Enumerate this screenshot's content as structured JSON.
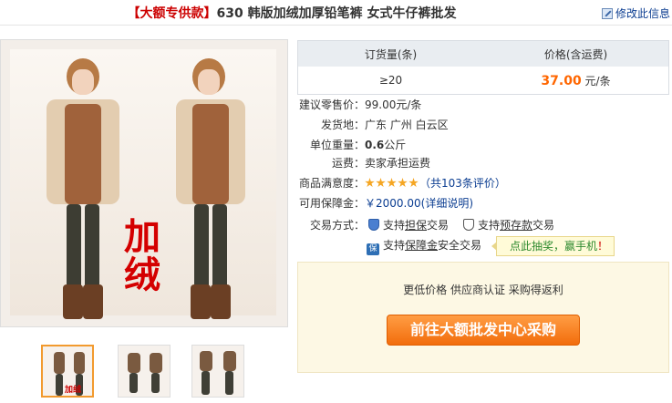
{
  "title": {
    "brand": "【大额专供款】",
    "text": "630 韩版加绒加厚铅笔裤 女式牛仔裤批发"
  },
  "edit_link": "修改此信息",
  "photo": {
    "overlay_text_1": "加",
    "overlay_text_2": "绒"
  },
  "thumbnails": {
    "first_label": "加绒"
  },
  "price_table": {
    "headers": [
      "订货量(条)",
      "价格(含运费)"
    ],
    "quantity": "≥20",
    "price": "37.00",
    "unit": " 元/条"
  },
  "info": {
    "retail_label": "建议零售价：",
    "retail_value": "99.00元/条",
    "ship_label": "发货地：",
    "ship_value": "广东 广州 白云区",
    "weight_label": "单位重量：",
    "weight_value": "0.6",
    "weight_unit": "公斤",
    "freight_label": "运费：",
    "freight_value": "卖家承担运费",
    "rating_label": "商品满意度：",
    "rating_stars": 5,
    "rating_count": "（共103条评价）",
    "guarantee_label": "可用保障金：",
    "guarantee_value": "￥2000.00",
    "guarantee_link": "(详细说明)",
    "trade_label": "交易方式：",
    "trade_1_prefix": "支持",
    "trade_1_link": "担保",
    "trade_1_suffix": "交易",
    "trade_2_prefix": "支持",
    "trade_2_link": "预存款",
    "trade_2_suffix": "交易",
    "trade_3_prefix": "支持",
    "trade_3_link": "保障金",
    "trade_3_suffix": "安全交易",
    "trade_3_icon_text": "保"
  },
  "tip": {
    "text": "点此抽奖，赢手机",
    "mark": "！"
  },
  "promo": {
    "text": "更低价格 供应商认证 采购得返利",
    "button": "前往大额批发中心采购"
  },
  "colors": {
    "price": "#ff6600",
    "button": "#f26d0c",
    "link": "#0b3d91"
  }
}
